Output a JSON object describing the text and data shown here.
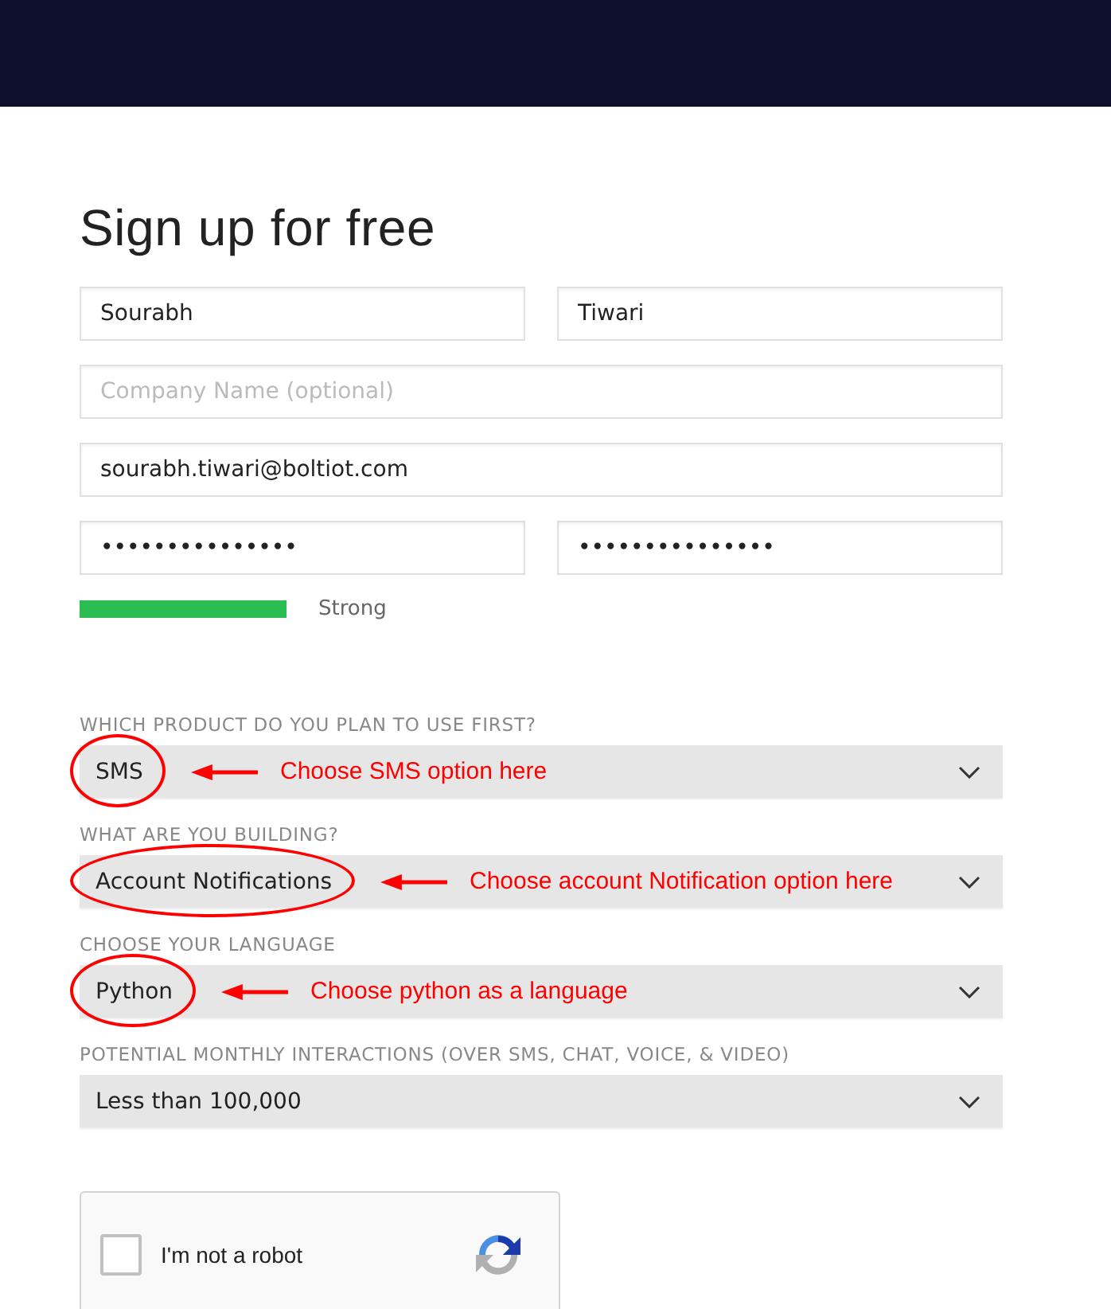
{
  "title": "Sign up for free",
  "field_rows": [
    [
      {
        "value": "Sourabh"
      },
      {
        "value": "Tiwari"
      }
    ],
    [
      {
        "placeholder": "Company Name (optional)"
      }
    ],
    [
      {
        "value": "sourabh.tiwari@boltiot.com"
      }
    ],
    [
      {
        "value": "•••••••••••••••"
      },
      {
        "value": "•••••••••••••••"
      }
    ]
  ],
  "strength": {
    "label": "Strong"
  },
  "selects": [
    {
      "label": "WHICH PRODUCT DO YOU PLAN TO USE FIRST?",
      "value": "SMS",
      "annotation": "Choose SMS option here"
    },
    {
      "label": "WHAT ARE YOU BUILDING?",
      "value": "Account Notifications",
      "annotation": "Choose account Notification option here"
    },
    {
      "label": "CHOOSE YOUR LANGUAGE",
      "value": "Python",
      "annotation": "Choose python as a language"
    },
    {
      "label": "POTENTIAL MONTHLY INTERACTIONS (OVER SMS, CHAT, VOICE, & VIDEO)",
      "value": "Less than 100,000"
    }
  ],
  "captcha": {
    "label": "I'm not a robot",
    "checked": false
  }
}
